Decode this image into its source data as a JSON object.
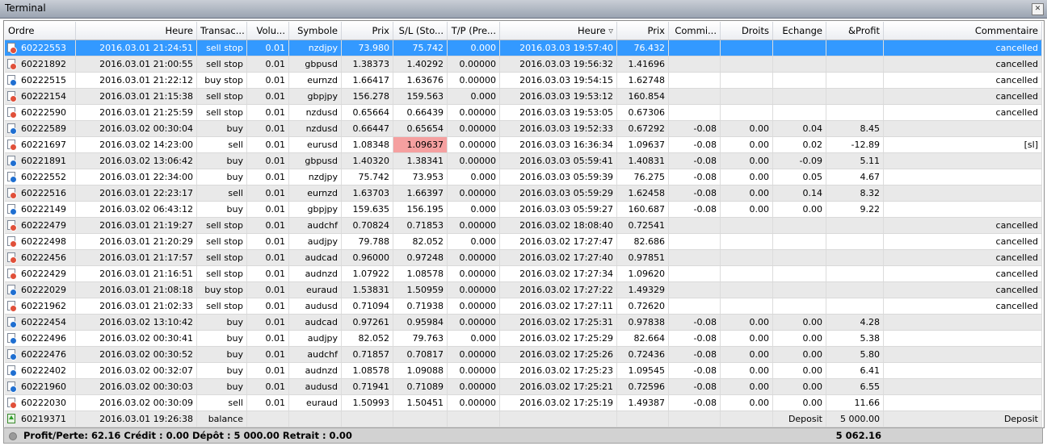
{
  "window": {
    "title": "Terminal"
  },
  "colors": {
    "selected_row": "#3399ff",
    "alt_row": "#e9e9e9",
    "sl_hit": "#f5a0a0",
    "buy_dot": "#1f6fd1",
    "sell_dot": "#e0503a",
    "header_band": "#9aa3b1"
  },
  "icons": {
    "order": "order-document-icon",
    "balance": "balance-arrow-icon",
    "sort": "sort-desc-icon",
    "close": "close-icon",
    "footer": "status-dot-icon"
  },
  "columns": [
    {
      "key": "ordre",
      "label": "Ordre"
    },
    {
      "key": "heure_open",
      "label": "Heure"
    },
    {
      "key": "transaction",
      "label": "Transac..."
    },
    {
      "key": "volume",
      "label": "Volu..."
    },
    {
      "key": "symbole",
      "label": "Symbole"
    },
    {
      "key": "prix_open",
      "label": "Prix"
    },
    {
      "key": "sl",
      "label": "S/L (Sto..."
    },
    {
      "key": "tp",
      "label": "T/P (Pre..."
    },
    {
      "key": "heure_close",
      "label": "Heure"
    },
    {
      "key": "prix_close",
      "label": "Prix"
    },
    {
      "key": "commission",
      "label": "Commi..."
    },
    {
      "key": "droits",
      "label": "Droits"
    },
    {
      "key": "echange",
      "label": "Echange"
    },
    {
      "key": "profit",
      "label": "&Profit"
    },
    {
      "key": "commentaire",
      "label": "Commentaire"
    }
  ],
  "rows": [
    {
      "ordre": "60222553",
      "heure_open": "2016.03.01 21:24:51",
      "transaction": "sell stop",
      "volume": "0.01",
      "symbole": "nzdjpy",
      "prix_open": "73.980",
      "sl": "75.742",
      "tp": "0.000",
      "heure_close": "2016.03.03 19:57:40",
      "prix_close": "76.432",
      "commission": "",
      "droits": "",
      "echange": "",
      "profit": "",
      "commentaire": "cancelled",
      "kind": "sell",
      "selected": true
    },
    {
      "ordre": "60221892",
      "heure_open": "2016.03.01 21:00:55",
      "transaction": "sell stop",
      "volume": "0.01",
      "symbole": "gbpusd",
      "prix_open": "1.38373",
      "sl": "1.40292",
      "tp": "0.00000",
      "heure_close": "2016.03.03 19:56:32",
      "prix_close": "1.41696",
      "commission": "",
      "droits": "",
      "echange": "",
      "profit": "",
      "commentaire": "cancelled",
      "kind": "sell"
    },
    {
      "ordre": "60222515",
      "heure_open": "2016.03.01 21:22:12",
      "transaction": "buy stop",
      "volume": "0.01",
      "symbole": "eurnzd",
      "prix_open": "1.66417",
      "sl": "1.63676",
      "tp": "0.00000",
      "heure_close": "2016.03.03 19:54:15",
      "prix_close": "1.62748",
      "commission": "",
      "droits": "",
      "echange": "",
      "profit": "",
      "commentaire": "cancelled",
      "kind": "buy"
    },
    {
      "ordre": "60222154",
      "heure_open": "2016.03.01 21:15:38",
      "transaction": "sell stop",
      "volume": "0.01",
      "symbole": "gbpjpy",
      "prix_open": "156.278",
      "sl": "159.563",
      "tp": "0.000",
      "heure_close": "2016.03.03 19:53:12",
      "prix_close": "160.854",
      "commission": "",
      "droits": "",
      "echange": "",
      "profit": "",
      "commentaire": "cancelled",
      "kind": "sell"
    },
    {
      "ordre": "60222590",
      "heure_open": "2016.03.01 21:25:59",
      "transaction": "sell stop",
      "volume": "0.01",
      "symbole": "nzdusd",
      "prix_open": "0.65664",
      "sl": "0.66439",
      "tp": "0.00000",
      "heure_close": "2016.03.03 19:53:05",
      "prix_close": "0.67306",
      "commission": "",
      "droits": "",
      "echange": "",
      "profit": "",
      "commentaire": "cancelled",
      "kind": "sell"
    },
    {
      "ordre": "60222589",
      "heure_open": "2016.03.02 00:30:04",
      "transaction": "buy",
      "volume": "0.01",
      "symbole": "nzdusd",
      "prix_open": "0.66447",
      "sl": "0.65654",
      "tp": "0.00000",
      "heure_close": "2016.03.03 19:52:33",
      "prix_close": "0.67292",
      "commission": "-0.08",
      "droits": "0.00",
      "echange": "0.04",
      "profit": "8.45",
      "commentaire": "",
      "kind": "buy"
    },
    {
      "ordre": "60221697",
      "heure_open": "2016.03.02 14:23:00",
      "transaction": "sell",
      "volume": "0.01",
      "symbole": "eurusd",
      "prix_open": "1.08348",
      "sl": "1.09637",
      "tp": "0.00000",
      "heure_close": "2016.03.03 16:36:34",
      "prix_close": "1.09637",
      "commission": "-0.08",
      "droits": "0.00",
      "echange": "0.02",
      "profit": "-12.89",
      "commentaire": "[sl]",
      "kind": "sell",
      "sl_hit": true
    },
    {
      "ordre": "60221891",
      "heure_open": "2016.03.02 13:06:42",
      "transaction": "buy",
      "volume": "0.01",
      "symbole": "gbpusd",
      "prix_open": "1.40320",
      "sl": "1.38341",
      "tp": "0.00000",
      "heure_close": "2016.03.03 05:59:41",
      "prix_close": "1.40831",
      "commission": "-0.08",
      "droits": "0.00",
      "echange": "-0.09",
      "profit": "5.11",
      "commentaire": "",
      "kind": "buy"
    },
    {
      "ordre": "60222552",
      "heure_open": "2016.03.01 22:34:00",
      "transaction": "buy",
      "volume": "0.01",
      "symbole": "nzdjpy",
      "prix_open": "75.742",
      "sl": "73.953",
      "tp": "0.000",
      "heure_close": "2016.03.03 05:59:39",
      "prix_close": "76.275",
      "commission": "-0.08",
      "droits": "0.00",
      "echange": "0.05",
      "profit": "4.67",
      "commentaire": "",
      "kind": "buy"
    },
    {
      "ordre": "60222516",
      "heure_open": "2016.03.01 22:23:17",
      "transaction": "sell",
      "volume": "0.01",
      "symbole": "eurnzd",
      "prix_open": "1.63703",
      "sl": "1.66397",
      "tp": "0.00000",
      "heure_close": "2016.03.03 05:59:29",
      "prix_close": "1.62458",
      "commission": "-0.08",
      "droits": "0.00",
      "echange": "0.14",
      "profit": "8.32",
      "commentaire": "",
      "kind": "sell"
    },
    {
      "ordre": "60222149",
      "heure_open": "2016.03.02 06:43:12",
      "transaction": "buy",
      "volume": "0.01",
      "symbole": "gbpjpy",
      "prix_open": "159.635",
      "sl": "156.195",
      "tp": "0.000",
      "heure_close": "2016.03.03 05:59:27",
      "prix_close": "160.687",
      "commission": "-0.08",
      "droits": "0.00",
      "echange": "0.00",
      "profit": "9.22",
      "commentaire": "",
      "kind": "buy"
    },
    {
      "ordre": "60222479",
      "heure_open": "2016.03.01 21:19:27",
      "transaction": "sell stop",
      "volume": "0.01",
      "symbole": "audchf",
      "prix_open": "0.70824",
      "sl": "0.71853",
      "tp": "0.00000",
      "heure_close": "2016.03.02 18:08:40",
      "prix_close": "0.72541",
      "commission": "",
      "droits": "",
      "echange": "",
      "profit": "",
      "commentaire": "cancelled",
      "kind": "sell"
    },
    {
      "ordre": "60222498",
      "heure_open": "2016.03.01 21:20:29",
      "transaction": "sell stop",
      "volume": "0.01",
      "symbole": "audjpy",
      "prix_open": "79.788",
      "sl": "82.052",
      "tp": "0.000",
      "heure_close": "2016.03.02 17:27:47",
      "prix_close": "82.686",
      "commission": "",
      "droits": "",
      "echange": "",
      "profit": "",
      "commentaire": "cancelled",
      "kind": "sell"
    },
    {
      "ordre": "60222456",
      "heure_open": "2016.03.01 21:17:57",
      "transaction": "sell stop",
      "volume": "0.01",
      "symbole": "audcad",
      "prix_open": "0.96000",
      "sl": "0.97248",
      "tp": "0.00000",
      "heure_close": "2016.03.02 17:27:40",
      "prix_close": "0.97851",
      "commission": "",
      "droits": "",
      "echange": "",
      "profit": "",
      "commentaire": "cancelled",
      "kind": "sell"
    },
    {
      "ordre": "60222429",
      "heure_open": "2016.03.01 21:16:51",
      "transaction": "sell stop",
      "volume": "0.01",
      "symbole": "audnzd",
      "prix_open": "1.07922",
      "sl": "1.08578",
      "tp": "0.00000",
      "heure_close": "2016.03.02 17:27:34",
      "prix_close": "1.09620",
      "commission": "",
      "droits": "",
      "echange": "",
      "profit": "",
      "commentaire": "cancelled",
      "kind": "sell"
    },
    {
      "ordre": "60222029",
      "heure_open": "2016.03.01 21:08:18",
      "transaction": "buy stop",
      "volume": "0.01",
      "symbole": "euraud",
      "prix_open": "1.53831",
      "sl": "1.50959",
      "tp": "0.00000",
      "heure_close": "2016.03.02 17:27:22",
      "prix_close": "1.49329",
      "commission": "",
      "droits": "",
      "echange": "",
      "profit": "",
      "commentaire": "cancelled",
      "kind": "buy"
    },
    {
      "ordre": "60221962",
      "heure_open": "2016.03.01 21:02:33",
      "transaction": "sell stop",
      "volume": "0.01",
      "symbole": "audusd",
      "prix_open": "0.71094",
      "sl": "0.71938",
      "tp": "0.00000",
      "heure_close": "2016.03.02 17:27:11",
      "prix_close": "0.72620",
      "commission": "",
      "droits": "",
      "echange": "",
      "profit": "",
      "commentaire": "cancelled",
      "kind": "sell"
    },
    {
      "ordre": "60222454",
      "heure_open": "2016.03.02 13:10:42",
      "transaction": "buy",
      "volume": "0.01",
      "symbole": "audcad",
      "prix_open": "0.97261",
      "sl": "0.95984",
      "tp": "0.00000",
      "heure_close": "2016.03.02 17:25:31",
      "prix_close": "0.97838",
      "commission": "-0.08",
      "droits": "0.00",
      "echange": "0.00",
      "profit": "4.28",
      "commentaire": "",
      "kind": "buy"
    },
    {
      "ordre": "60222496",
      "heure_open": "2016.03.02 00:30:41",
      "transaction": "buy",
      "volume": "0.01",
      "symbole": "audjpy",
      "prix_open": "82.052",
      "sl": "79.763",
      "tp": "0.000",
      "heure_close": "2016.03.02 17:25:29",
      "prix_close": "82.664",
      "commission": "-0.08",
      "droits": "0.00",
      "echange": "0.00",
      "profit": "5.38",
      "commentaire": "",
      "kind": "buy"
    },
    {
      "ordre": "60222476",
      "heure_open": "2016.03.02 00:30:52",
      "transaction": "buy",
      "volume": "0.01",
      "symbole": "audchf",
      "prix_open": "0.71857",
      "sl": "0.70817",
      "tp": "0.00000",
      "heure_close": "2016.03.02 17:25:26",
      "prix_close": "0.72436",
      "commission": "-0.08",
      "droits": "0.00",
      "echange": "0.00",
      "profit": "5.80",
      "commentaire": "",
      "kind": "buy"
    },
    {
      "ordre": "60222402",
      "heure_open": "2016.03.02 00:32:07",
      "transaction": "buy",
      "volume": "0.01",
      "symbole": "audnzd",
      "prix_open": "1.08578",
      "sl": "1.09088",
      "tp": "0.00000",
      "heure_close": "2016.03.02 17:25:23",
      "prix_close": "1.09545",
      "commission": "-0.08",
      "droits": "0.00",
      "echange": "0.00",
      "profit": "6.41",
      "commentaire": "",
      "kind": "buy"
    },
    {
      "ordre": "60221960",
      "heure_open": "2016.03.02 00:30:03",
      "transaction": "buy",
      "volume": "0.01",
      "symbole": "audusd",
      "prix_open": "0.71941",
      "sl": "0.71089",
      "tp": "0.00000",
      "heure_close": "2016.03.02 17:25:21",
      "prix_close": "0.72596",
      "commission": "-0.08",
      "droits": "0.00",
      "echange": "0.00",
      "profit": "6.55",
      "commentaire": "",
      "kind": "buy"
    },
    {
      "ordre": "60222030",
      "heure_open": "2016.03.02 00:30:09",
      "transaction": "sell",
      "volume": "0.01",
      "symbole": "euraud",
      "prix_open": "1.50993",
      "sl": "1.50451",
      "tp": "0.00000",
      "heure_close": "2016.03.02 17:25:19",
      "prix_close": "1.49387",
      "commission": "-0.08",
      "droits": "0.00",
      "echange": "0.00",
      "profit": "11.66",
      "commentaire": "",
      "kind": "sell"
    },
    {
      "ordre": "60219371",
      "heure_open": "2016.03.01 19:26:38",
      "transaction": "balance",
      "volume": "",
      "symbole": "",
      "prix_open": "",
      "sl": "",
      "tp": "",
      "heure_close": "",
      "prix_close": "",
      "commission": "",
      "droits": "",
      "echange": "Deposit",
      "profit": "5 000.00",
      "commentaire": "Deposit",
      "kind": "balance"
    }
  ],
  "footer": {
    "summary": "Profit/Perte: 62.16  Crédit : 0.00  Dépôt : 5 000.00  Retrait : 0.00",
    "total": "5 062.16"
  }
}
